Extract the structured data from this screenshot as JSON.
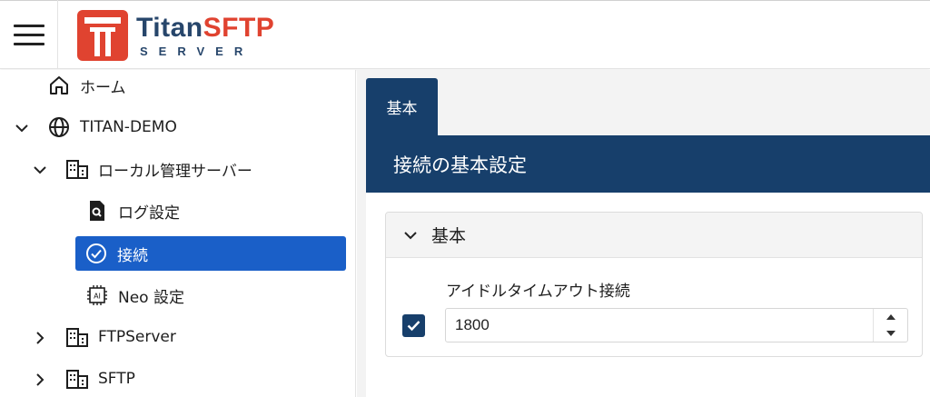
{
  "header": {
    "logo_title_part1": "Titan",
    "logo_title_part2": "SFTP",
    "logo_subtitle": "SERVER"
  },
  "sidebar": {
    "items": [
      {
        "label": "ホーム",
        "icon": "home-icon"
      },
      {
        "label": "TITAN-DEMO",
        "icon": "globe-icon",
        "expanded": true
      },
      {
        "label": "ローカル管理サーバー",
        "icon": "server-icon",
        "expanded": true
      },
      {
        "label": "ログ設定",
        "icon": "log-search-icon"
      },
      {
        "label": "接続",
        "icon": "check-circle-icon",
        "active": true
      },
      {
        "label": "Neo 設定",
        "icon": "ai-chip-icon"
      },
      {
        "label": "FTPServer",
        "icon": "server-icon",
        "expanded": false
      },
      {
        "label": "SFTP",
        "icon": "server-icon",
        "expanded": false
      }
    ]
  },
  "main": {
    "tab_label": "基本",
    "panel_title": "接続の基本設定",
    "section_title": "基本",
    "idle_timeout": {
      "label": "アイドルタイムアウト接続",
      "enabled": true,
      "value": "1800"
    }
  },
  "colors": {
    "accent_navy": "#173f6b",
    "active_blue": "#1a5fc8",
    "logo_red": "#e04330"
  }
}
